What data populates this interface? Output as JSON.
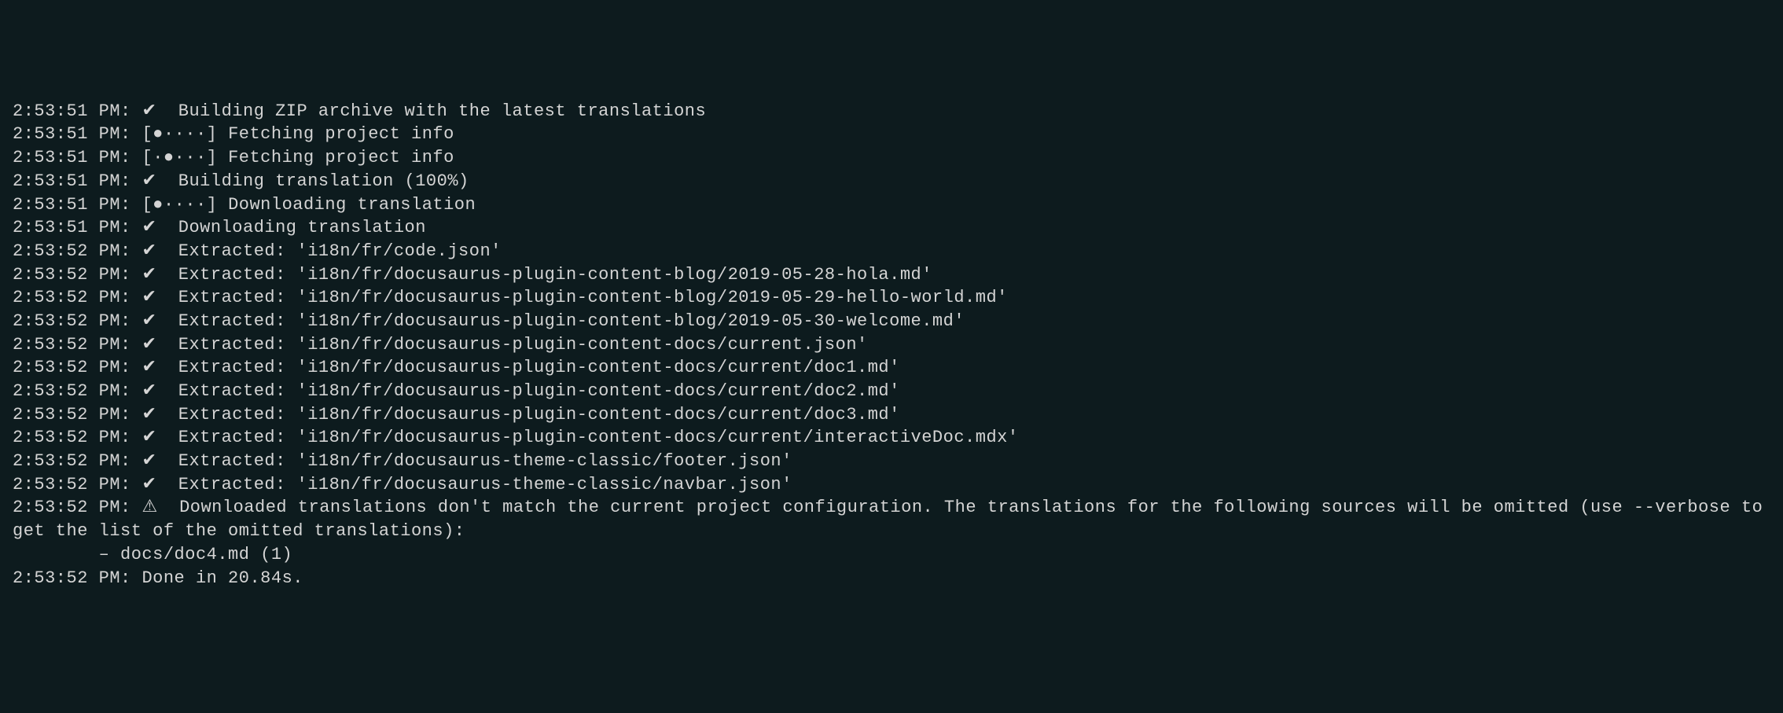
{
  "log": {
    "lines": [
      {
        "timestamp": "2:53:51 PM:",
        "icon": "✔",
        "iconType": "check",
        "message": " Building ZIP archive with the latest translations"
      },
      {
        "timestamp": "2:53:51 PM:",
        "icon": "[●∙∙∙∙]",
        "iconType": "spinner",
        "message": "Fetching project info"
      },
      {
        "timestamp": "2:53:51 PM:",
        "icon": "[∙●∙∙∙]",
        "iconType": "spinner",
        "message": "Fetching project info"
      },
      {
        "timestamp": "2:53:51 PM:",
        "icon": "✔",
        "iconType": "check",
        "message": " Building translation (100%)"
      },
      {
        "timestamp": "2:53:51 PM:",
        "icon": "[●∙∙∙∙]",
        "iconType": "spinner",
        "message": "Downloading translation"
      },
      {
        "timestamp": "2:53:51 PM:",
        "icon": "✔",
        "iconType": "check",
        "message": " Downloading translation"
      },
      {
        "timestamp": "2:53:52 PM:",
        "icon": "✔",
        "iconType": "check",
        "message": " Extracted: 'i18n/fr/code.json'"
      },
      {
        "timestamp": "2:53:52 PM:",
        "icon": "✔",
        "iconType": "check",
        "message": " Extracted: 'i18n/fr/docusaurus-plugin-content-blog/2019-05-28-hola.md'"
      },
      {
        "timestamp": "2:53:52 PM:",
        "icon": "✔",
        "iconType": "check",
        "message": " Extracted: 'i18n/fr/docusaurus-plugin-content-blog/2019-05-29-hello-world.md'"
      },
      {
        "timestamp": "2:53:52 PM:",
        "icon": "✔",
        "iconType": "check",
        "message": " Extracted: 'i18n/fr/docusaurus-plugin-content-blog/2019-05-30-welcome.md'"
      },
      {
        "timestamp": "2:53:52 PM:",
        "icon": "✔",
        "iconType": "check",
        "message": " Extracted: 'i18n/fr/docusaurus-plugin-content-docs/current.json'"
      },
      {
        "timestamp": "2:53:52 PM:",
        "icon": "✔",
        "iconType": "check",
        "message": " Extracted: 'i18n/fr/docusaurus-plugin-content-docs/current/doc1.md'"
      },
      {
        "timestamp": "2:53:52 PM:",
        "icon": "✔",
        "iconType": "check",
        "message": " Extracted: 'i18n/fr/docusaurus-plugin-content-docs/current/doc2.md'"
      },
      {
        "timestamp": "2:53:52 PM:",
        "icon": "✔",
        "iconType": "check",
        "message": " Extracted: 'i18n/fr/docusaurus-plugin-content-docs/current/doc3.md'"
      },
      {
        "timestamp": "2:53:52 PM:",
        "icon": "✔",
        "iconType": "check",
        "message": " Extracted: 'i18n/fr/docusaurus-plugin-content-docs/current/interactiveDoc.mdx'"
      },
      {
        "timestamp": "2:53:52 PM:",
        "icon": "✔",
        "iconType": "check",
        "message": " Extracted: 'i18n/fr/docusaurus-theme-classic/footer.json'"
      },
      {
        "timestamp": "2:53:52 PM:",
        "icon": "✔",
        "iconType": "check",
        "message": " Extracted: 'i18n/fr/docusaurus-theme-classic/navbar.json'"
      },
      {
        "timestamp": "2:53:52 PM:",
        "icon": "⚠",
        "iconType": "warn",
        "message": " Downloaded translations don't match the current project configuration. The translations for the following sources will be omitted (use --verbose to get the list of the omitted translations):"
      },
      {
        "timestamp": "",
        "icon": "",
        "iconType": "none",
        "message": "        – docs/doc4.md (1)"
      },
      {
        "timestamp": "2:53:52 PM:",
        "icon": "",
        "iconType": "none",
        "message": "Done in 20.84s."
      }
    ]
  }
}
